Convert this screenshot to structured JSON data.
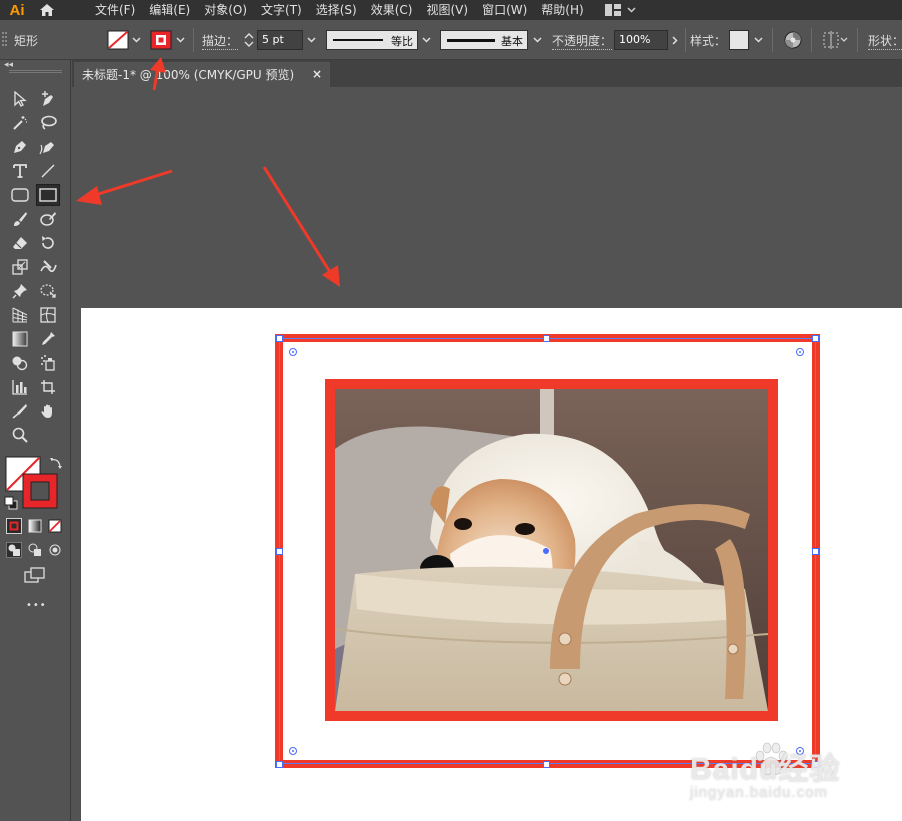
{
  "app": {
    "logo": "Ai"
  },
  "menu": {
    "items": [
      "文件(F)",
      "编辑(E)",
      "对象(O)",
      "文字(T)",
      "选择(S)",
      "效果(C)",
      "视图(V)",
      "窗口(W)",
      "帮助(H)"
    ]
  },
  "controlbar": {
    "object_type": "矩形",
    "stroke_label": "描边：",
    "stroke_weight": "5 pt",
    "profile_label": "等比",
    "brush_label": "基本",
    "opacity_label": "不透明度：",
    "opacity_value": "100%",
    "style_label": "样式：",
    "shape_label": "形状："
  },
  "document": {
    "tab_title": "未标题-1* @ 100% (CMYK/GPU 预览)",
    "close_glyph": "×"
  },
  "toolbar": {
    "more_glyph": "•••",
    "collapse_glyph": "◂◂"
  },
  "colors": {
    "accent_red": "#ef3a2a",
    "selection_blue": "#4a6cff",
    "ui_dark": "#323232",
    "ui_mid": "#535353"
  },
  "watermark": {
    "main": "Baidu经验",
    "sub": "jingyan.baidu.com"
  }
}
